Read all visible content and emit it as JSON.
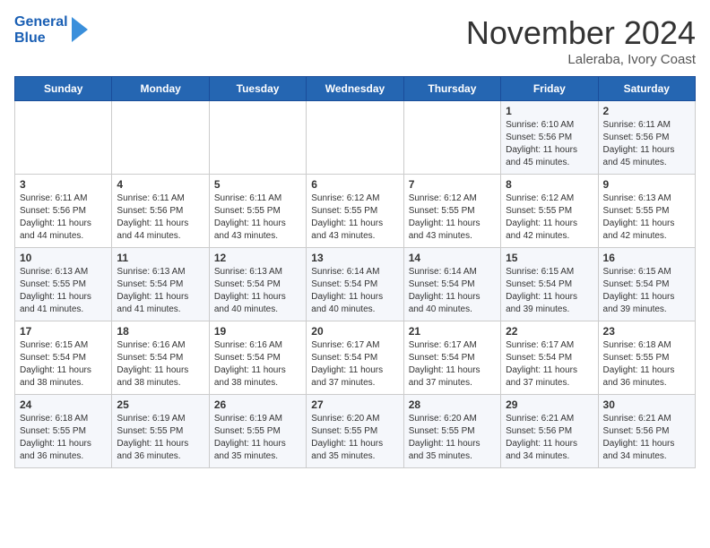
{
  "header": {
    "logo_line1": "General",
    "logo_line2": "Blue",
    "month": "November 2024",
    "location": "Laleraba, Ivory Coast"
  },
  "days_of_week": [
    "Sunday",
    "Monday",
    "Tuesday",
    "Wednesday",
    "Thursday",
    "Friday",
    "Saturday"
  ],
  "weeks": [
    [
      {
        "day": "",
        "info": ""
      },
      {
        "day": "",
        "info": ""
      },
      {
        "day": "",
        "info": ""
      },
      {
        "day": "",
        "info": ""
      },
      {
        "day": "",
        "info": ""
      },
      {
        "day": "1",
        "info": "Sunrise: 6:10 AM\nSunset: 5:56 PM\nDaylight: 11 hours\nand 45 minutes."
      },
      {
        "day": "2",
        "info": "Sunrise: 6:11 AM\nSunset: 5:56 PM\nDaylight: 11 hours\nand 45 minutes."
      }
    ],
    [
      {
        "day": "3",
        "info": "Sunrise: 6:11 AM\nSunset: 5:56 PM\nDaylight: 11 hours\nand 44 minutes."
      },
      {
        "day": "4",
        "info": "Sunrise: 6:11 AM\nSunset: 5:56 PM\nDaylight: 11 hours\nand 44 minutes."
      },
      {
        "day": "5",
        "info": "Sunrise: 6:11 AM\nSunset: 5:55 PM\nDaylight: 11 hours\nand 43 minutes."
      },
      {
        "day": "6",
        "info": "Sunrise: 6:12 AM\nSunset: 5:55 PM\nDaylight: 11 hours\nand 43 minutes."
      },
      {
        "day": "7",
        "info": "Sunrise: 6:12 AM\nSunset: 5:55 PM\nDaylight: 11 hours\nand 43 minutes."
      },
      {
        "day": "8",
        "info": "Sunrise: 6:12 AM\nSunset: 5:55 PM\nDaylight: 11 hours\nand 42 minutes."
      },
      {
        "day": "9",
        "info": "Sunrise: 6:13 AM\nSunset: 5:55 PM\nDaylight: 11 hours\nand 42 minutes."
      }
    ],
    [
      {
        "day": "10",
        "info": "Sunrise: 6:13 AM\nSunset: 5:55 PM\nDaylight: 11 hours\nand 41 minutes."
      },
      {
        "day": "11",
        "info": "Sunrise: 6:13 AM\nSunset: 5:54 PM\nDaylight: 11 hours\nand 41 minutes."
      },
      {
        "day": "12",
        "info": "Sunrise: 6:13 AM\nSunset: 5:54 PM\nDaylight: 11 hours\nand 40 minutes."
      },
      {
        "day": "13",
        "info": "Sunrise: 6:14 AM\nSunset: 5:54 PM\nDaylight: 11 hours\nand 40 minutes."
      },
      {
        "day": "14",
        "info": "Sunrise: 6:14 AM\nSunset: 5:54 PM\nDaylight: 11 hours\nand 40 minutes."
      },
      {
        "day": "15",
        "info": "Sunrise: 6:15 AM\nSunset: 5:54 PM\nDaylight: 11 hours\nand 39 minutes."
      },
      {
        "day": "16",
        "info": "Sunrise: 6:15 AM\nSunset: 5:54 PM\nDaylight: 11 hours\nand 39 minutes."
      }
    ],
    [
      {
        "day": "17",
        "info": "Sunrise: 6:15 AM\nSunset: 5:54 PM\nDaylight: 11 hours\nand 38 minutes."
      },
      {
        "day": "18",
        "info": "Sunrise: 6:16 AM\nSunset: 5:54 PM\nDaylight: 11 hours\nand 38 minutes."
      },
      {
        "day": "19",
        "info": "Sunrise: 6:16 AM\nSunset: 5:54 PM\nDaylight: 11 hours\nand 38 minutes."
      },
      {
        "day": "20",
        "info": "Sunrise: 6:17 AM\nSunset: 5:54 PM\nDaylight: 11 hours\nand 37 minutes."
      },
      {
        "day": "21",
        "info": "Sunrise: 6:17 AM\nSunset: 5:54 PM\nDaylight: 11 hours\nand 37 minutes."
      },
      {
        "day": "22",
        "info": "Sunrise: 6:17 AM\nSunset: 5:54 PM\nDaylight: 11 hours\nand 37 minutes."
      },
      {
        "day": "23",
        "info": "Sunrise: 6:18 AM\nSunset: 5:55 PM\nDaylight: 11 hours\nand 36 minutes."
      }
    ],
    [
      {
        "day": "24",
        "info": "Sunrise: 6:18 AM\nSunset: 5:55 PM\nDaylight: 11 hours\nand 36 minutes."
      },
      {
        "day": "25",
        "info": "Sunrise: 6:19 AM\nSunset: 5:55 PM\nDaylight: 11 hours\nand 36 minutes."
      },
      {
        "day": "26",
        "info": "Sunrise: 6:19 AM\nSunset: 5:55 PM\nDaylight: 11 hours\nand 35 minutes."
      },
      {
        "day": "27",
        "info": "Sunrise: 6:20 AM\nSunset: 5:55 PM\nDaylight: 11 hours\nand 35 minutes."
      },
      {
        "day": "28",
        "info": "Sunrise: 6:20 AM\nSunset: 5:55 PM\nDaylight: 11 hours\nand 35 minutes."
      },
      {
        "day": "29",
        "info": "Sunrise: 6:21 AM\nSunset: 5:56 PM\nDaylight: 11 hours\nand 34 minutes."
      },
      {
        "day": "30",
        "info": "Sunrise: 6:21 AM\nSunset: 5:56 PM\nDaylight: 11 hours\nand 34 minutes."
      }
    ]
  ]
}
